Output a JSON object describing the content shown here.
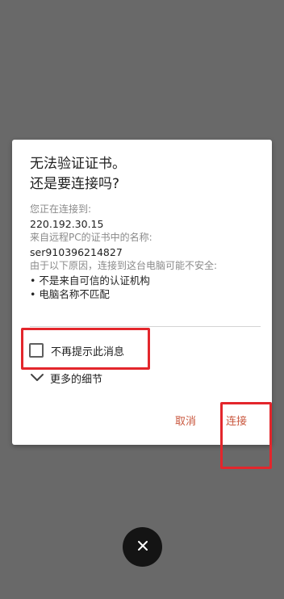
{
  "dialog": {
    "title_line1": "无法验证证书。",
    "title_line2": "还是要连接吗?",
    "connecting_label": "您正在连接到:",
    "connecting_value": "220.192.30.15",
    "cert_name_label": "来自远程PC的证书中的名称:",
    "cert_name_value": "ser910396214827",
    "reason_label": "由于以下原因，连接到这台电脑可能不安全:",
    "reasons": [
      "• 不是来自可信的认证机构",
      "• 电脑名称不匹配"
    ],
    "dont_show_again_label": "不再提示此消息",
    "dont_show_again_checked": false,
    "more_details_label": "更多的细节",
    "cancel_label": "取消",
    "connect_label": "连接"
  },
  "icons": {
    "checkbox": "checkbox-empty",
    "expand": "chevron-down-icon",
    "close": "close-icon"
  },
  "colors": {
    "backdrop": "#696969",
    "dialog_bg": "#ffffff",
    "accent_button_text": "#c9573e",
    "highlight_border": "#e3262c",
    "close_button_bg": "#141414"
  }
}
